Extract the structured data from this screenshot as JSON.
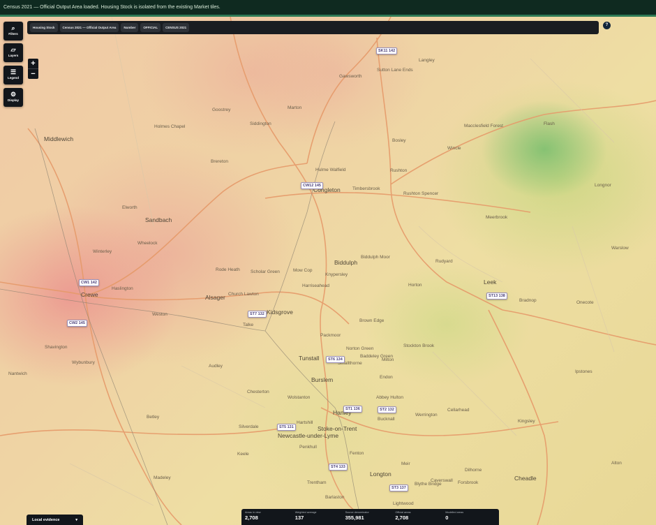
{
  "banner": {
    "message": "Census 2021 — Official Output Area loaded. Housing Stock is isolated from the existing Market tiles."
  },
  "rail": {
    "filters": "Filters",
    "layers": "Layers",
    "legend": "Legend",
    "display": "Display"
  },
  "zoom": {
    "in": "+",
    "out": "−"
  },
  "chips": [
    "Housing Stock",
    "Census 2021 — Official Output Area",
    "Number",
    "OFFICIAL",
    "CENSUS 2021"
  ],
  "help": "?",
  "places": {
    "middlewich": "Middlewich",
    "sandbach": "Sandbach",
    "crewe": "Crewe",
    "alsager": "Alsager",
    "kidsgrove": "Kidsgrove",
    "biddulph": "Biddulph",
    "leek": "Leek",
    "tunstall": "Tunstall",
    "burslem": "Burslem",
    "hanley": "Hanley",
    "stoke": "Stoke-on-Trent",
    "newcastle": "Newcastle-under-Lyme",
    "congleton": "Congleton",
    "cheadle": "Cheadle",
    "longton": "Longton",
    "fenton": "Fenton",
    "mow_cop": "Mow Cop",
    "church_lawton": "Church Lawton",
    "rushton_spencer": "Rushton Spencer",
    "holmes_chapel": "Holmes Chapel",
    "wheelock": "Wheelock",
    "haslington": "Haslington",
    "wybunbury": "Wybunbury",
    "audley": "Audley",
    "silverdale": "Silverdale",
    "bucknall": "Bucknall",
    "werrington": "Werrington",
    "endon": "Endon",
    "cellarhead": "Cellarhead",
    "bosley": "Bosley",
    "wincle": "Wincle",
    "meerbrook": "Meerbrook",
    "rudyard": "Rudyard",
    "warslow": "Warslow",
    "ipstones": "Ipstones",
    "kingsley": "Kingsley",
    "alton": "Alton",
    "blythe_bridge": "Blythe Bridge",
    "caverswall": "Caverswall",
    "packmoor": "Packmoor",
    "brown_edge": "Brown Edge",
    "smallthorne": "Smallthorne",
    "abbey_hulton": "Abbey Hulton",
    "penkhull": "Penkhull",
    "trentham": "Trentham",
    "barlaston": "Barlaston",
    "madeley": "Madeley",
    "keele": "Keele",
    "betley": "Betley",
    "weston": "Weston",
    "shavington": "Shavington",
    "nantwich": "Nantwich",
    "winterley": "Winterley",
    "elworth": "Elworth",
    "goostrey": "Goostrey",
    "brereton": "Brereton",
    "timbersbrook": "Timbersbrook",
    "hulme_walfield": "Hulme Walfield",
    "marton": "Marton",
    "siddington": "Siddington",
    "gawsworth": "Gawsworth",
    "sutton_lane_ends": "Sutton Lane Ends",
    "langley": "Langley",
    "macclesfield_forest": "Macclesfield Forest",
    "flash": "Flash",
    "longnor": "Longnor",
    "onecote": "Onecote",
    "bradnop": "Bradnop",
    "horton": "Horton",
    "rushton": "Rushton",
    "biddulph_moor": "Biddulph Moor",
    "knypersley": "Knypersley",
    "norton_green": "Norton Green",
    "milton": "Milton",
    "baddeley_green": "Baddeley Green",
    "stockton_brook": "Stockton Brook",
    "harriseahead": "Harriseahead",
    "scholar_green": "Scholar Green",
    "rode_heath": "Rode Heath",
    "talke": "Talke",
    "chesterton": "Chesterton",
    "wolstanton": "Wolstanton",
    "hartshill": "Hartshill",
    "meir": "Meir",
    "lightwood": "Lightwood",
    "dilhorne": "Dilhorne",
    "forsbrook": "Forsbrook"
  },
  "markers": [
    "SK11 142",
    "CW12 145",
    "CW1 142",
    "CW2 145",
    "ST7 132",
    "ST6 134",
    "ST1 136",
    "ST2 132",
    "ST5 131",
    "ST4 133",
    "ST3 137",
    "ST13 138"
  ],
  "local_evidence": {
    "label": "Local evidence",
    "chevron": "▾"
  },
  "stats": [
    {
      "label": "Areas in view",
      "value": "2,708"
    },
    {
      "label": "Weighted average",
      "value": "137"
    },
    {
      "label": "Source denominator",
      "value": "355,981"
    },
    {
      "label": "Official areas",
      "value": "2,708"
    },
    {
      "label": "Modelled areas",
      "value": "0"
    }
  ],
  "colors": {
    "banner_bg": "#0f2a20",
    "banner_accent": "#2e7a55",
    "panel_bg": "#12161b",
    "marker_text": "#4a3f7a",
    "road_major": "#e69a6a"
  }
}
